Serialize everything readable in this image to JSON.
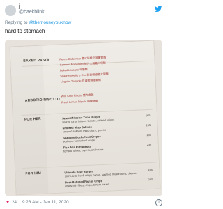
{
  "tweet": {
    "display_name": "j",
    "handle": "@baekblink",
    "reply_prefix": "Replying to",
    "reply_to": "@themouseyouknow",
    "text": "hard to stomach",
    "likes": "24",
    "timestamp": "9:23 AM - Jan 11, 2020"
  },
  "menu": {
    "sections": [
      {
        "key": "pasta",
        "label": "BAKED PASTA"
      },
      {
        "key": "risotto",
        "label": "ARBORIO RISOTTO"
      },
      {
        "key": "for_her",
        "label": "FOR HER"
      },
      {
        "key": "for_him",
        "label": "FOR HIM"
      }
    ],
    "pasta_items": [
      "Penne Carbonara 意式培根奶油筆管麵",
      "Gamberi Pomodoro 茄汁大蝦義大利麵",
      "Baked Lasagna 千層麵",
      "Spaghetti Aglio e Olio 蒜香辣椒義大利麵",
      "Linguine Vongole 白酒蛤蜊細扁麵"
    ],
    "risotto_items": [
      "Wild Crab Risotto 蟹肉燉飯",
      "Fresh Lemon Risotto 檸檬燉飯"
    ],
    "her_items": [
      {
        "title": "Seared Nicoise Tuna Burger",
        "desc": "seared tuna, lettuce, tomato, pickled onions",
        "price": "165"
      },
      {
        "title": "Smoked Miso Salmon",
        "desc": "smoked salmon, miso glaze, greens",
        "price": "155"
      },
      {
        "title": "Scallops Buckwheat Crepes",
        "desc": "scallops, buckwheat crepe",
        "price": "165"
      },
      {
        "title": "Fish Alla Puttanesca",
        "desc": "tomato, olives, capers, anchovies",
        "price": "235"
      }
    ],
    "him_items": [
      {
        "title": "Ultimate Beef Burger",
        "desc": "100% U.S. beef, crispy bacon, sauteed mushrooms, cheese",
        "price": "165"
      },
      {
        "title": "Beer-Battered Fish n' Chips",
        "desc": "crispy fish fillets, chips, tartare sauce",
        "price": "165"
      }
    ]
  },
  "colors": {
    "link": "#1b95e0",
    "muted": "#657786",
    "heart": "#e0245e",
    "paper": "#efece7"
  }
}
